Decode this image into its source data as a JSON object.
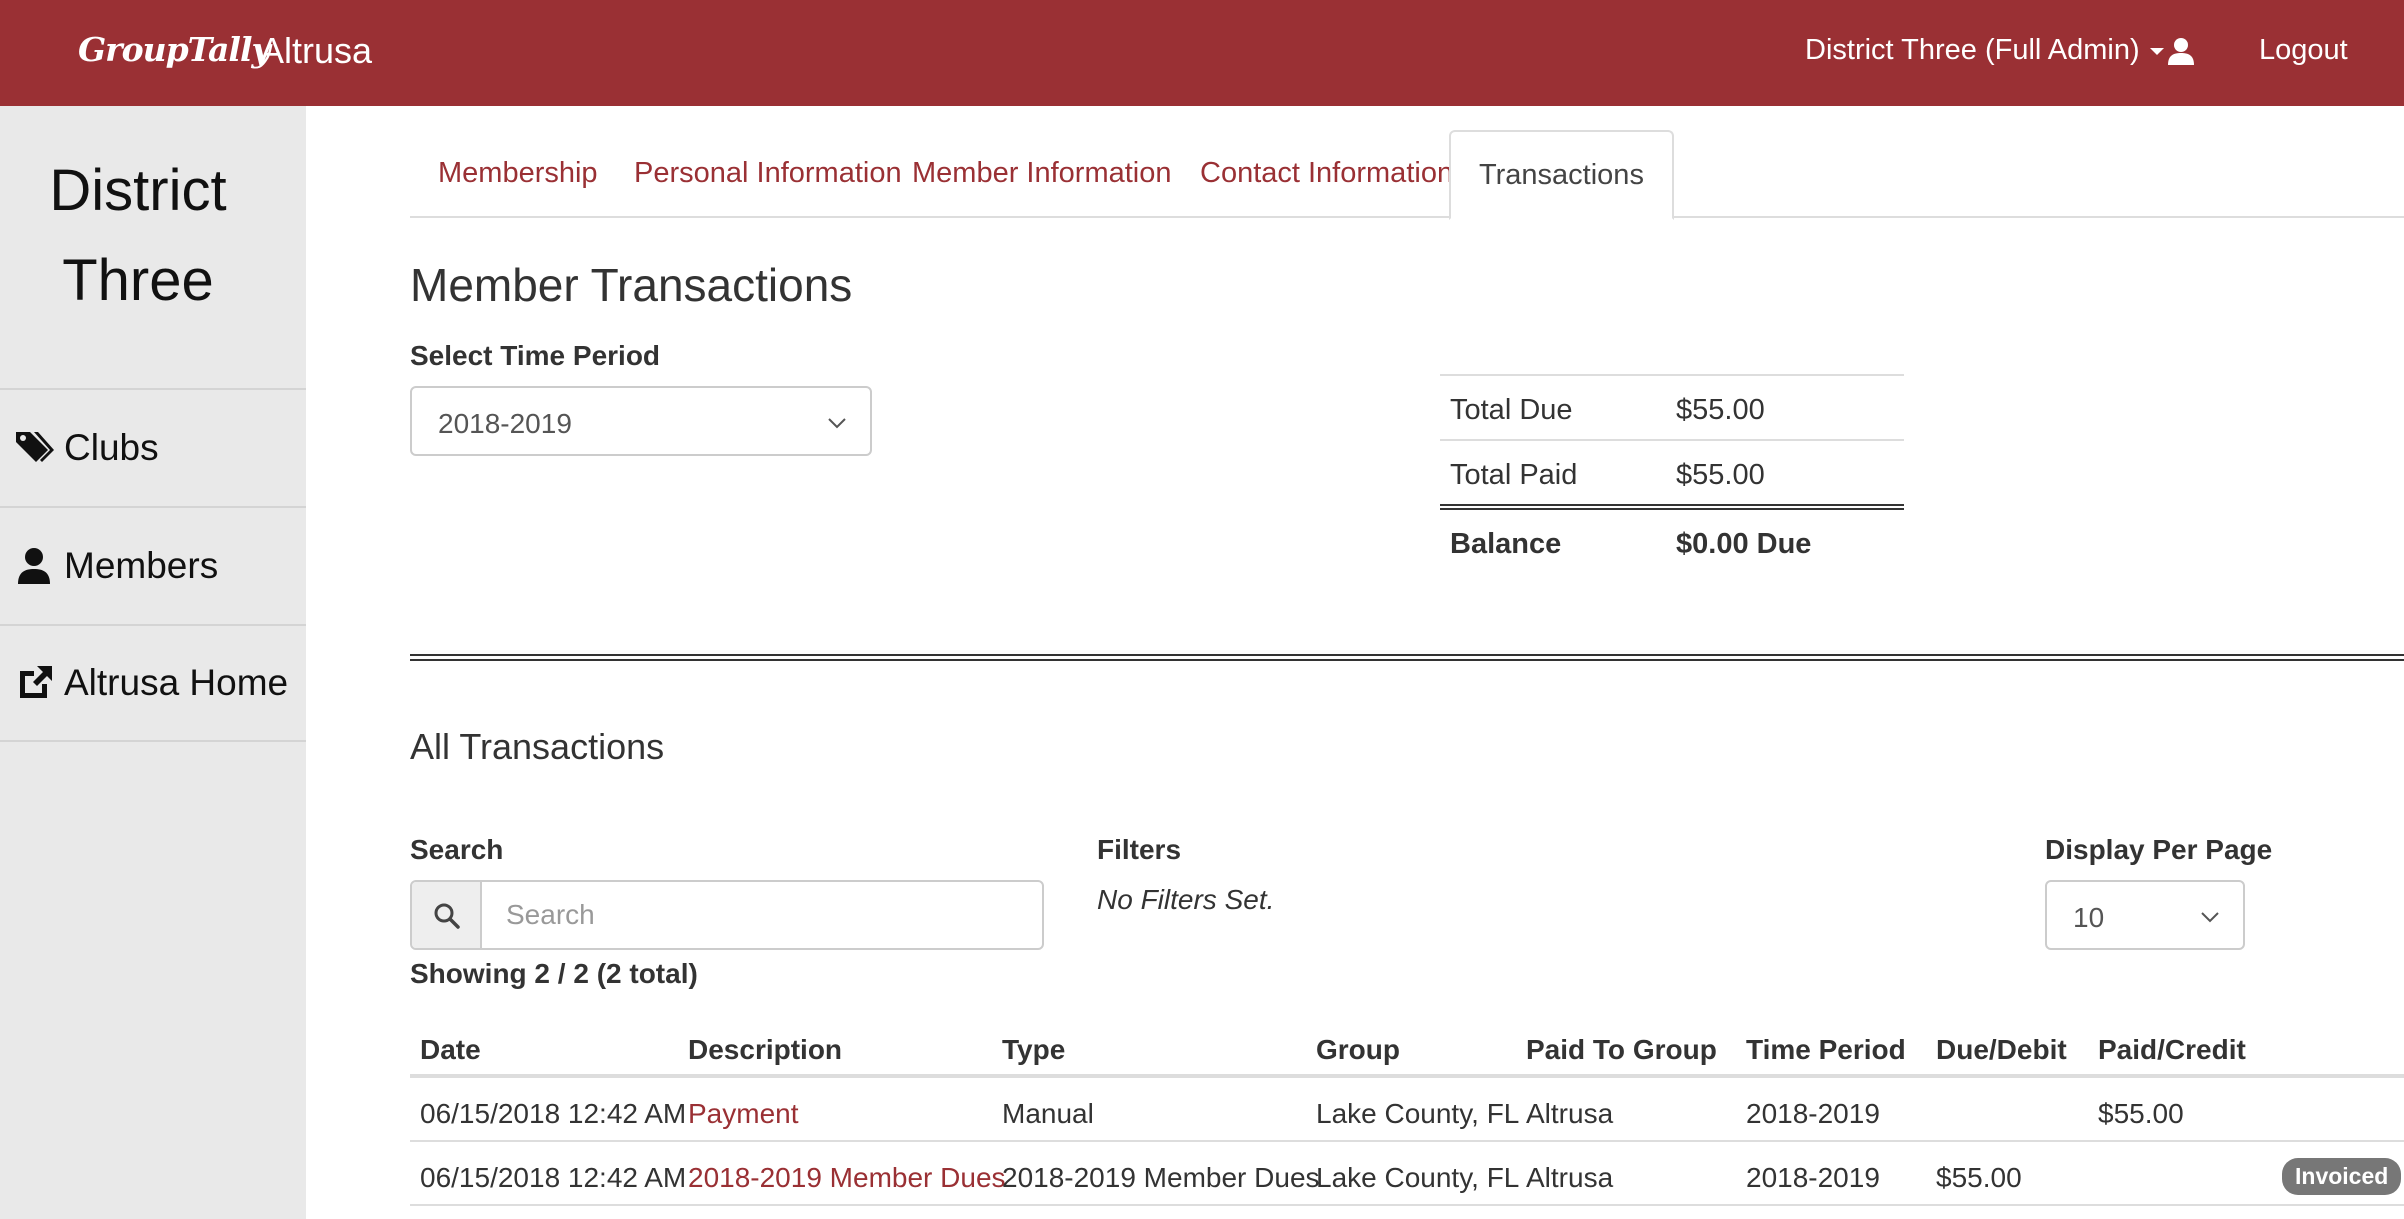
{
  "header": {
    "brand": "GroupTally",
    "org": "Altrusa",
    "admin_label": "District Three (Full Admin)",
    "logout_label": "Logout"
  },
  "sidebar": {
    "title_line1": "District",
    "title_line2": "Three",
    "items": [
      {
        "label": "Clubs",
        "icon": "tags-icon"
      },
      {
        "label": "Members",
        "icon": "user-icon"
      },
      {
        "label": "Altrusa Home",
        "icon": "external-link-icon"
      }
    ]
  },
  "tabs": [
    {
      "label": "Membership"
    },
    {
      "label": "Personal Information"
    },
    {
      "label": "Member Information"
    },
    {
      "label": "Contact Information"
    },
    {
      "label": "Transactions",
      "active": true
    }
  ],
  "member_transactions": {
    "title": "Member Transactions",
    "period_label": "Select Time Period",
    "period_value": "2018-2019"
  },
  "summary": {
    "total_due_label": "Total Due",
    "total_due_value": "$55.00",
    "total_paid_label": "Total Paid",
    "total_paid_value": "$55.00",
    "balance_label": "Balance",
    "balance_value": "$0.00 Due"
  },
  "all_transactions": {
    "title": "All Transactions",
    "search_label": "Search",
    "search_placeholder": "Search",
    "filters_label": "Filters",
    "filters_value": "No Filters Set.",
    "per_page_label": "Display Per Page",
    "per_page_value": "10",
    "showing": "Showing 2 / 2 (2 total)"
  },
  "table": {
    "headers": [
      "Date",
      "Description",
      "Type",
      "Group",
      "Paid To Group",
      "Time Period",
      "Due/Debit",
      "Paid/Credit"
    ],
    "rows": [
      {
        "date": "06/15/2018 12:42 AM",
        "description": "Payment",
        "type": "Manual",
        "group": "Lake County, FL",
        "paid_to": "Altrusa",
        "period": "2018-2019",
        "due": "",
        "paid": "$55.00",
        "badge": ""
      },
      {
        "date": "06/15/2018 12:42 AM",
        "description": "2018-2019 Member Dues",
        "type": "2018-2019 Member Dues",
        "group": "Lake County, FL",
        "paid_to": "Altrusa",
        "period": "2018-2019",
        "due": "$55.00",
        "paid": "",
        "badge": "Invoiced"
      }
    ]
  },
  "colors": {
    "brand": "#9a3034",
    "sidebar_bg": "#e9e9e9",
    "badge_bg": "#777777"
  }
}
